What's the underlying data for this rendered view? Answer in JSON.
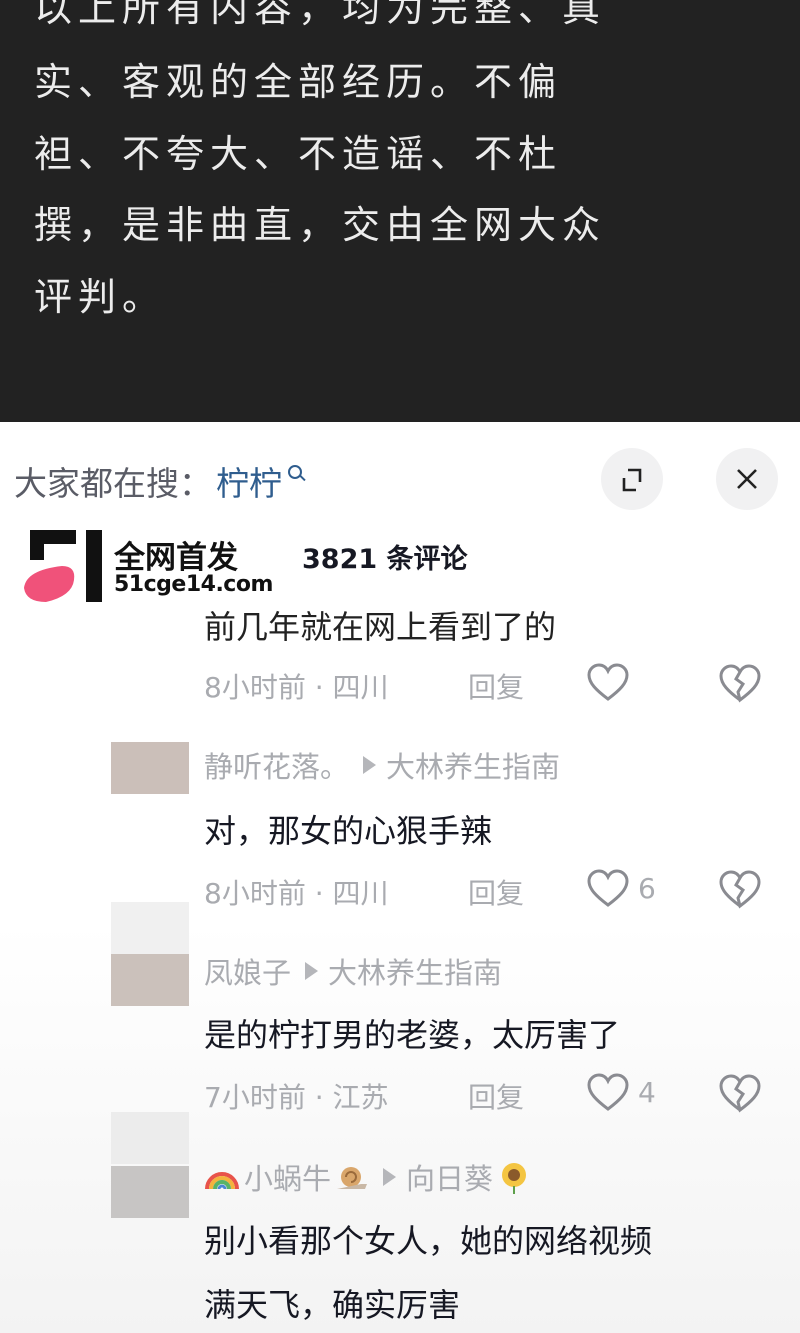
{
  "post_text": {
    "lines": [
      "以上所有内容，均为完整、真",
      "实、客观的全部经历。不偏",
      "袒、不夸大、不造谣、不杜",
      "撰，是非曲直，交由全网大众",
      "评判。"
    ]
  },
  "search": {
    "prefix": "大家都在搜：",
    "term": "柠柠"
  },
  "watermark": {
    "title": "全网首发",
    "url": "51cge14.com"
  },
  "comments_header": {
    "count": "3821 条评论"
  },
  "comments": [
    {
      "text": "前几年就在网上看到了的",
      "time_location": "8小时前 · 四川",
      "reply_label": "回复",
      "likes": ""
    },
    {
      "author": "静听花落。",
      "reply_to": "大林养生指南",
      "text": "对，那女的心狠手辣",
      "time_location": "8小时前 · 四川",
      "reply_label": "回复",
      "likes": "6"
    },
    {
      "author": "凤娘子",
      "reply_to": "大林养生指南",
      "text": "是的柠打男的老婆，太厉害了",
      "time_location": "7小时前 · 江苏",
      "reply_label": "回复",
      "likes": "4"
    },
    {
      "author": "小蜗牛",
      "reply_to": "向日葵",
      "text_lines": [
        "别小看那个女人，她的网络视频",
        "满天飞，确实厉害"
      ]
    }
  ],
  "colors": {
    "dark_bg": "#222222",
    "search_term": "#2f5d8e",
    "meta_gray": "#a9abb0",
    "logo_pink": "#f0527a"
  }
}
